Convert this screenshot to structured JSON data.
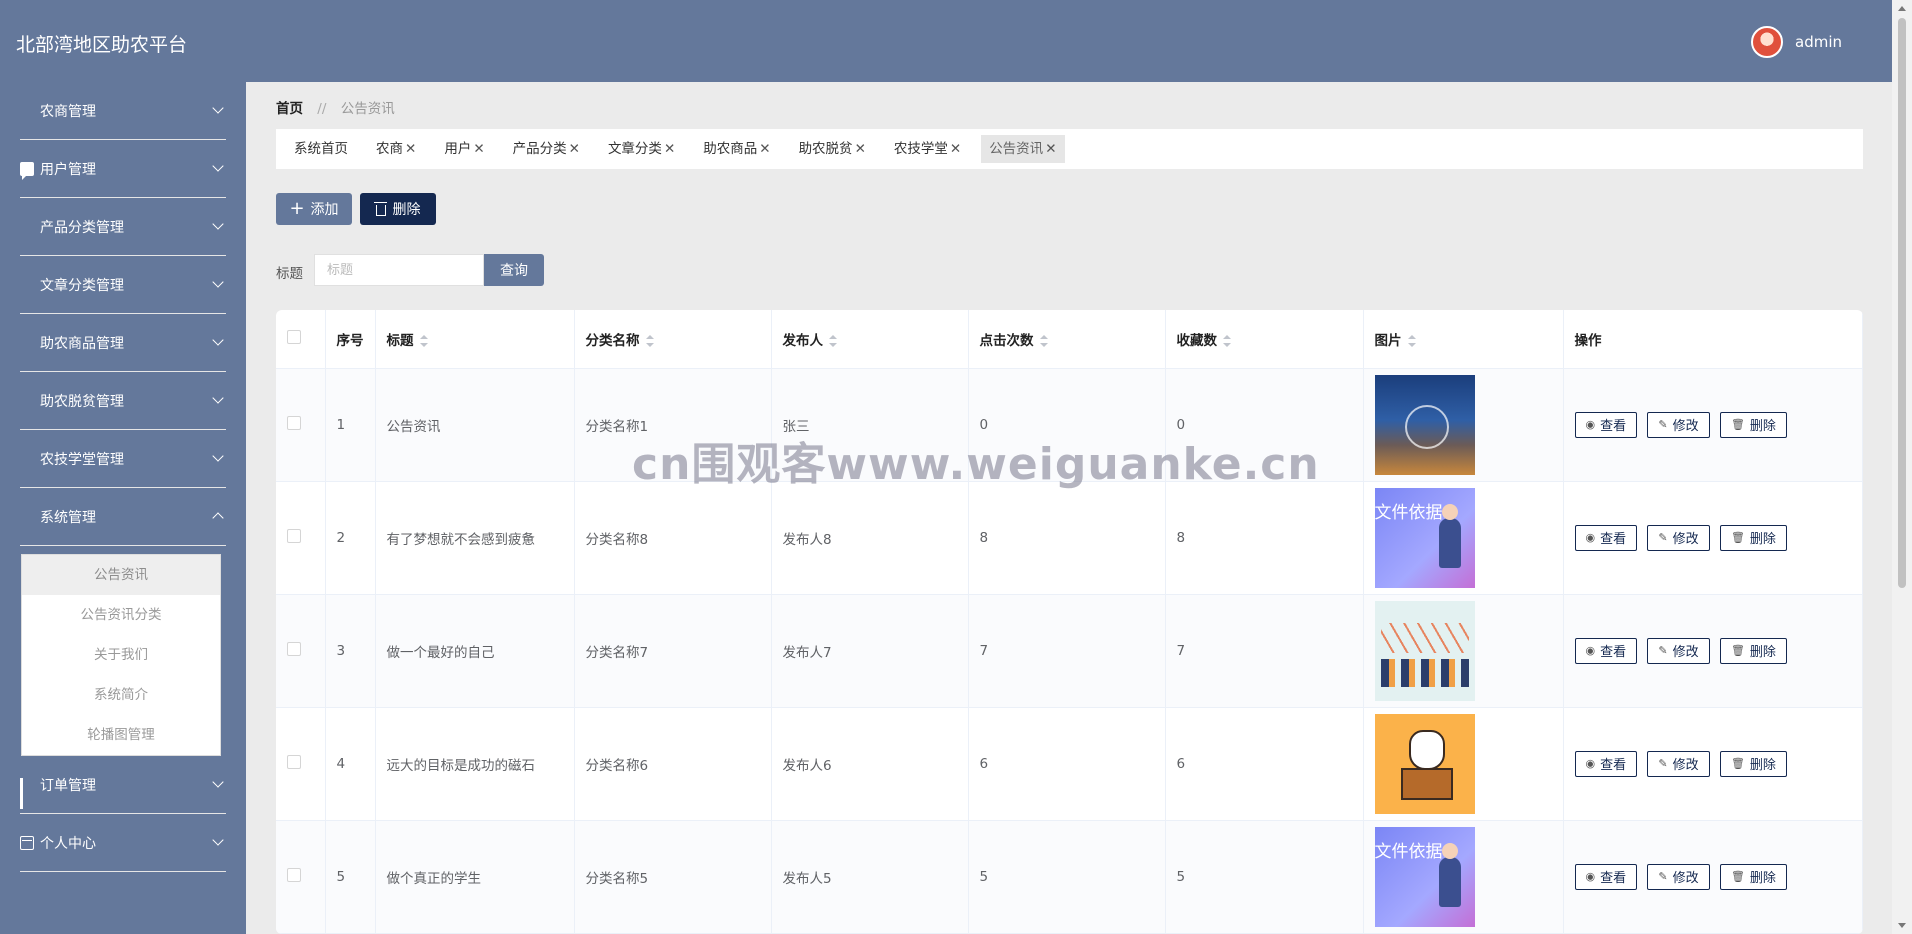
{
  "header": {
    "app_title": "北部湾地区助农平台",
    "username": "admin"
  },
  "sidebar": {
    "items": [
      {
        "label": "农商管理",
        "icon": "grid-icon"
      },
      {
        "label": "用户管理",
        "icon": "chat-icon"
      },
      {
        "label": "产品分类管理",
        "icon": "grid-icon"
      },
      {
        "label": "文章分类管理",
        "icon": "grid9-icon"
      },
      {
        "label": "助农商品管理",
        "icon": "grid-icon"
      },
      {
        "label": "助农脱贫管理",
        "icon": "grid-icon"
      },
      {
        "label": "农技学堂管理",
        "icon": "grid-icon"
      },
      {
        "label": "系统管理",
        "icon": "grid-icon",
        "expanded": true
      },
      {
        "label": "订单管理",
        "icon": "bar-chart-icon"
      },
      {
        "label": "个人中心",
        "icon": "wallet-icon"
      }
    ],
    "submenu": [
      "公告资讯",
      "公告资讯分类",
      "关于我们",
      "系统简介",
      "轮播图管理"
    ]
  },
  "breadcrumb": {
    "home": "首页",
    "separator": "//",
    "current": "公告资讯"
  },
  "tabs": [
    {
      "label": "系统首页",
      "closable": false
    },
    {
      "label": "农商",
      "closable": true
    },
    {
      "label": "用户",
      "closable": true
    },
    {
      "label": "产品分类",
      "closable": true
    },
    {
      "label": "文章分类",
      "closable": true
    },
    {
      "label": "助农商品",
      "closable": true
    },
    {
      "label": "助农脱贫",
      "closable": true
    },
    {
      "label": "农技学堂",
      "closable": true
    },
    {
      "label": "公告资讯",
      "closable": true,
      "active": true
    }
  ],
  "toolbar": {
    "add_label": "添加",
    "delete_label": "删除"
  },
  "search": {
    "label": "标题",
    "placeholder": "标题",
    "value": "",
    "button_label": "查询"
  },
  "table": {
    "headers": [
      "序号",
      "标题",
      "分类名称",
      "发布人",
      "点击次数",
      "收藏数",
      "图片",
      "操作"
    ],
    "rows": [
      {
        "no": "1",
        "title": "公告资讯",
        "category": "分类名称1",
        "publisher": "张三",
        "clicks": "0",
        "favorites": "0",
        "image": "city-network"
      },
      {
        "no": "2",
        "title": "有了梦想就不会感到疲惫",
        "category": "分类名称8",
        "publisher": "发布人8",
        "clicks": "8",
        "favorites": "8",
        "image": "document-basis",
        "image_text": "文件依据"
      },
      {
        "no": "3",
        "title": "做一个最好的自己",
        "category": "分类名称7",
        "publisher": "发布人7",
        "clicks": "7",
        "favorites": "7",
        "image": "business-chart"
      },
      {
        "no": "4",
        "title": "远大的目标是成功的磁石",
        "category": "分类名称6",
        "publisher": "发布人6",
        "clicks": "6",
        "favorites": "6",
        "image": "corgi-box"
      },
      {
        "no": "5",
        "title": "做个真正的学生",
        "category": "分类名称5",
        "publisher": "发布人5",
        "clicks": "5",
        "favorites": "5",
        "image": "document-basis",
        "image_text": "文件依据"
      }
    ],
    "actions": {
      "view": "查看",
      "edit": "修改",
      "delete": "删除"
    }
  },
  "watermark": "cn围观客www.weiguanke.cn",
  "colors": {
    "header_bg": "#64789b",
    "primary_dark": "#142850",
    "page_bg": "#ebebeb"
  }
}
